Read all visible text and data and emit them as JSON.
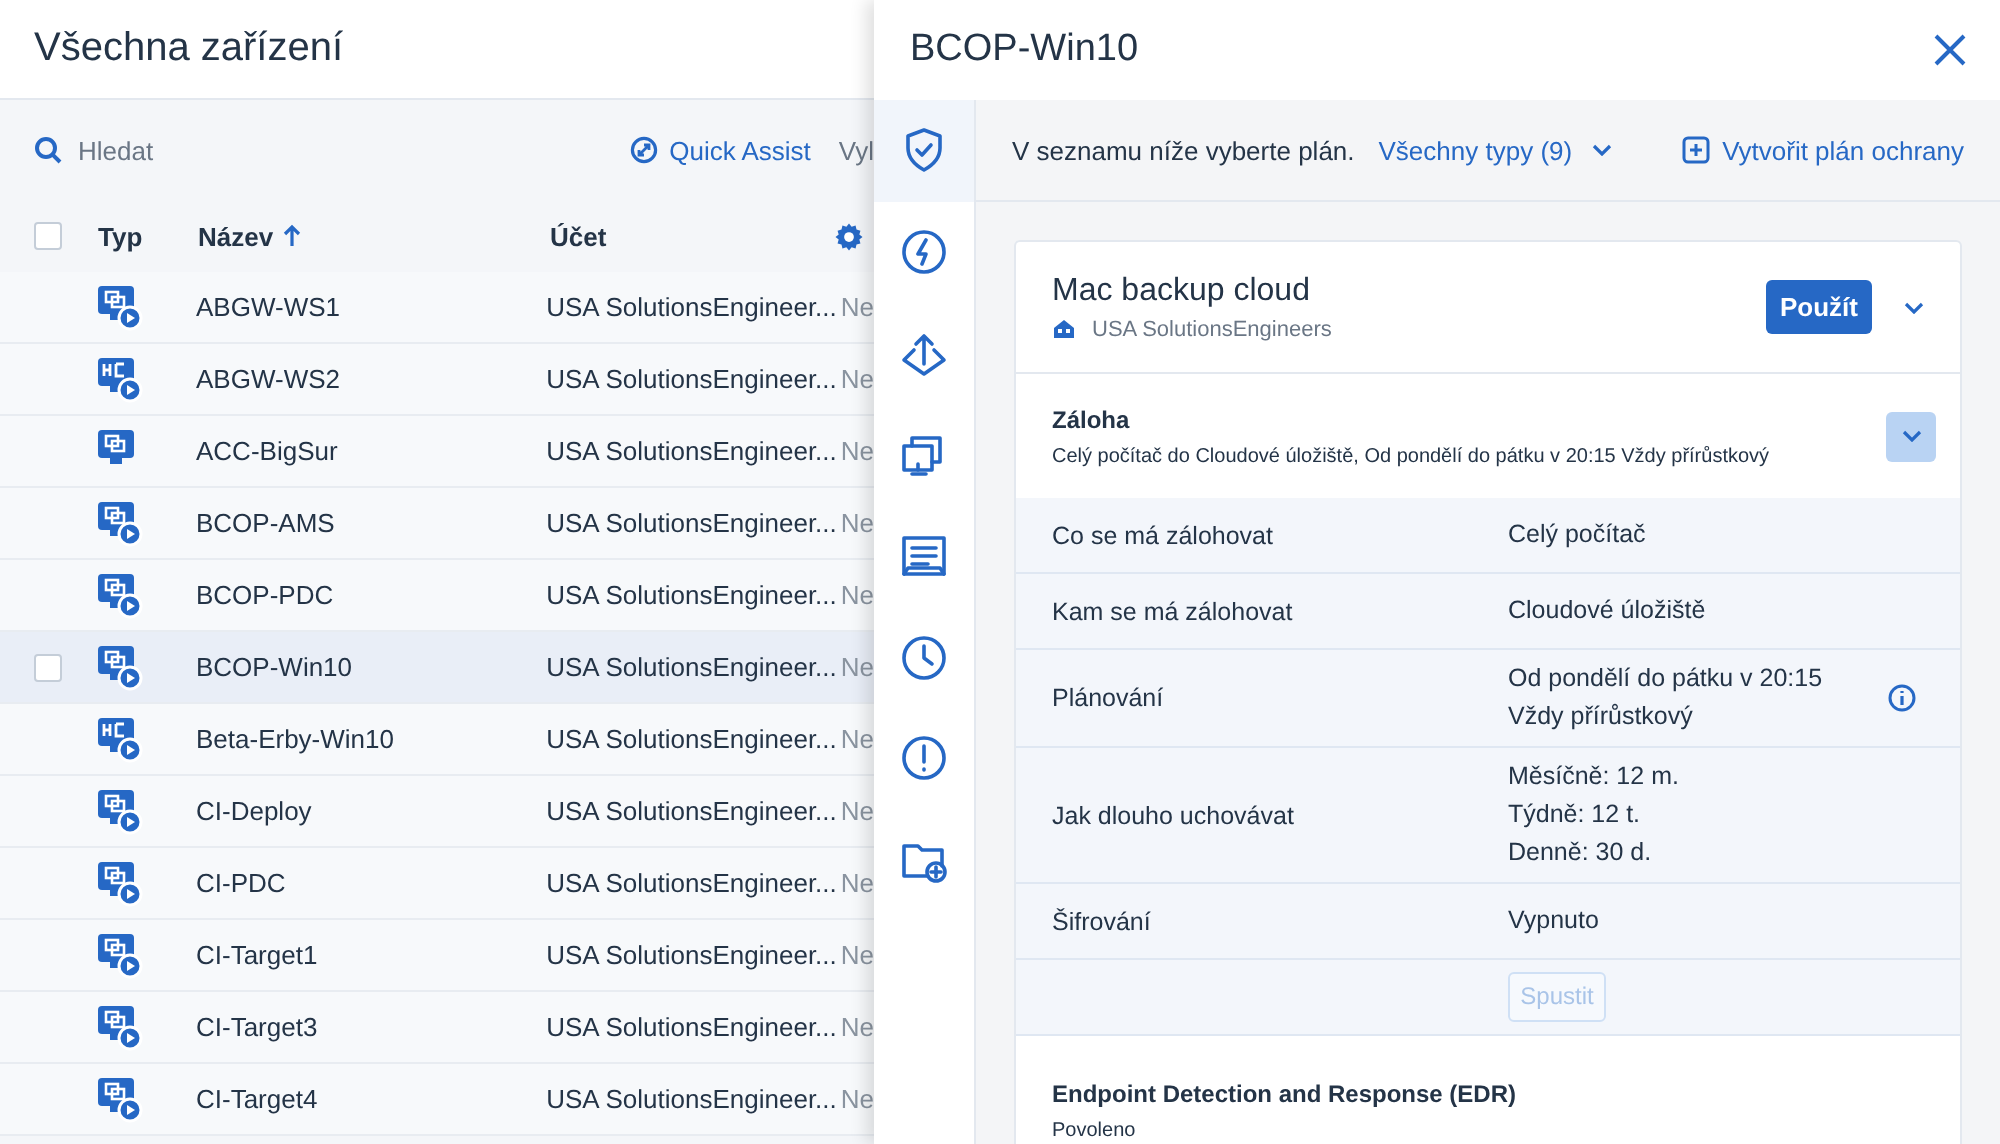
{
  "page": {
    "title": "Všechna zařízení",
    "search": {
      "placeholder": "Hledat"
    },
    "quick_assist": "Quick Assist",
    "toolbar_cut": "Vyl"
  },
  "table": {
    "select_all": {
      "checked": false
    },
    "columns": [
      {
        "label": "Typ",
        "sorted": false
      },
      {
        "label": "Název",
        "sorted": true
      },
      {
        "label": "Účet",
        "sorted": false
      }
    ],
    "rows": [
      {
        "kind": "vm",
        "name": "ABGW-WS1",
        "account": "USA SolutionsEngineer...",
        "column_4": "Ne",
        "selected": false
      },
      {
        "kind": "hc",
        "name": "ABGW-WS2",
        "account": "USA SolutionsEngineer...",
        "column_4": "Ne",
        "selected": false
      },
      {
        "kind": "monitor",
        "name": "ACC-BigSur",
        "account": "USA SolutionsEngineer...",
        "column_4": "Ne",
        "selected": false
      },
      {
        "kind": "vm",
        "name": "BCOP-AMS",
        "account": "USA SolutionsEngineer...",
        "column_4": "Ne",
        "selected": false
      },
      {
        "kind": "vm",
        "name": "BCOP-PDC",
        "account": "USA SolutionsEngineer...",
        "column_4": "Ne",
        "selected": false
      },
      {
        "kind": "vm",
        "name": "BCOP-Win10",
        "account": "USA SolutionsEngineer...",
        "column_4": "Ne",
        "selected": true
      },
      {
        "kind": "hc",
        "name": "Beta-Erby-Win10",
        "account": "USA SolutionsEngineer...",
        "column_4": "Ne",
        "selected": false
      },
      {
        "kind": "vm",
        "name": "CI-Deploy",
        "account": "USA SolutionsEngineer...",
        "column_4": "Ne",
        "selected": false
      },
      {
        "kind": "vm",
        "name": "CI-PDC",
        "account": "USA SolutionsEngineer...",
        "column_4": "Ne",
        "selected": false
      },
      {
        "kind": "vm",
        "name": "CI-Target1",
        "account": "USA SolutionsEngineer...",
        "column_4": "Ne",
        "selected": false
      },
      {
        "kind": "vm",
        "name": "CI-Target3",
        "account": "USA SolutionsEngineer...",
        "column_4": "Ne",
        "selected": false
      },
      {
        "kind": "vm",
        "name": "CI-Target4",
        "account": "USA SolutionsEngineer...",
        "column_4": "Ne",
        "selected": false
      }
    ]
  },
  "panel": {
    "title": "BCOP-Win10",
    "rail": [
      {
        "kind": "shield",
        "selected": true
      },
      {
        "kind": "bolt",
        "selected": false
      },
      {
        "kind": "upload",
        "selected": false
      },
      {
        "kind": "windows",
        "selected": false
      },
      {
        "kind": "document",
        "selected": false
      },
      {
        "kind": "clock",
        "selected": false
      },
      {
        "kind": "alert",
        "selected": false
      },
      {
        "kind": "folder",
        "selected": false
      }
    ],
    "toolbar": {
      "prompt": "V seznamu níže vyberte plán.",
      "filter": "Všechny typy (9)",
      "create": "Vytvořit plán ochrany"
    },
    "plan": {
      "name": "Mac backup cloud",
      "apply": "Použít",
      "owner": "USA SolutionsEngineers",
      "backup": {
        "title": "Záloha",
        "summary": "Celý počítač do Cloudové úložiště, Od pondělí do pátku v 20:15 Vždy přírůstkový",
        "expanded": true,
        "rows": [
          {
            "label": "Co se má zálohovat",
            "values": [
              "Celý počítač"
            ],
            "info": false
          },
          {
            "label": "Kam se má zálohovat",
            "values": [
              "Cloudové úložiště"
            ],
            "info": false
          },
          {
            "label": "Plánování",
            "values": [
              "Od pondělí do pátku v 20:15 Vždy přírůstkový"
            ],
            "info": true
          },
          {
            "label": "Jak dlouho uchovávat",
            "values": [
              "Měsíčně: 12 m.",
              "Týdně: 12 t.",
              "Denně: 30 d."
            ],
            "info": false
          },
          {
            "label": "Šifrování",
            "values": [
              "Vypnuto"
            ],
            "info": false
          }
        ],
        "run": {
          "label": "Spustit",
          "disabled": true
        }
      },
      "edr": {
        "title": "Endpoint Detection and Response (EDR)",
        "status": "Povoleno"
      }
    }
  }
}
